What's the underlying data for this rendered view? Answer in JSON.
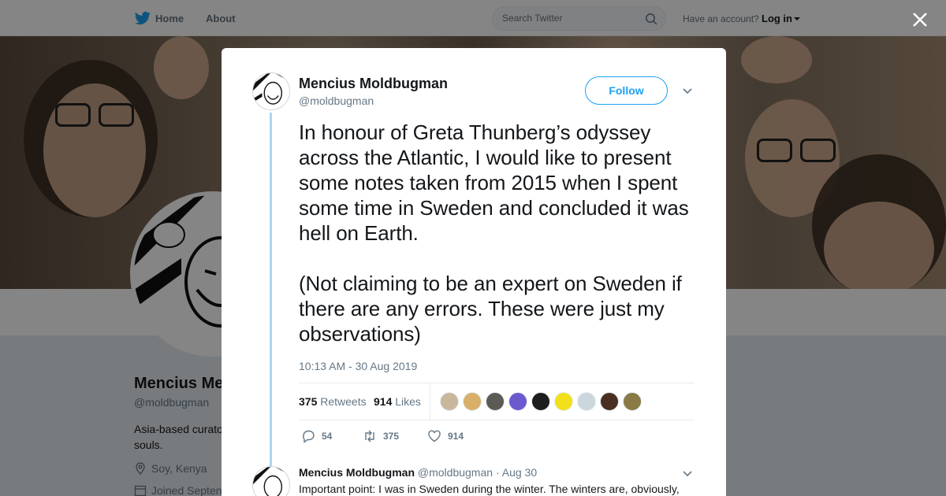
{
  "nav": {
    "home": "Home",
    "about": "About",
    "search_placeholder": "Search Twitter",
    "have_account": "Have an account?",
    "login": "Log in"
  },
  "profile": {
    "name": "Mencius Me",
    "handle": "@moldbugman",
    "bio": "Asia-based curato souls.",
    "location": "Soy, Kenya",
    "joined": "Joined Septen"
  },
  "tweet": {
    "name": "Mencius Moldbugman",
    "handle": "@moldbugman",
    "follow_label": "Follow",
    "text_p1": "In honour of Greta Thunberg’s odyssey across the Atlantic, I would like to present some notes taken from 2015 when I spent some time in Sweden and concluded it was hell on Earth.",
    "text_p2": "(Not claiming to be an expert on Sweden if there are any errors. These were just my observations)",
    "timestamp": "10:13 AM - 30 Aug 2019",
    "retweets_count": "375",
    "retweets_label": "Retweets",
    "likes_count": "914",
    "likes_label": "Likes",
    "liker_colors": [
      "#c9b79c",
      "#d8b06a",
      "#5c5a55",
      "#6a5acd",
      "#1d1d1d",
      "#f2e11a",
      "#ccd6dd",
      "#4a2e22",
      "#8a7a45"
    ],
    "actions": {
      "replies": "54",
      "retweets": "375",
      "likes": "914"
    }
  },
  "reply": {
    "name": "Mencius Moldbugman",
    "handle": "@moldbugman",
    "dot": "·",
    "date": "Aug 30",
    "text": "Important point: I was in Sweden during the winter. The winters are, obviously,"
  },
  "colors": {
    "brand": "#1da1f2",
    "thread_line": "#a8d7f3",
    "secondary_text": "#657786"
  }
}
